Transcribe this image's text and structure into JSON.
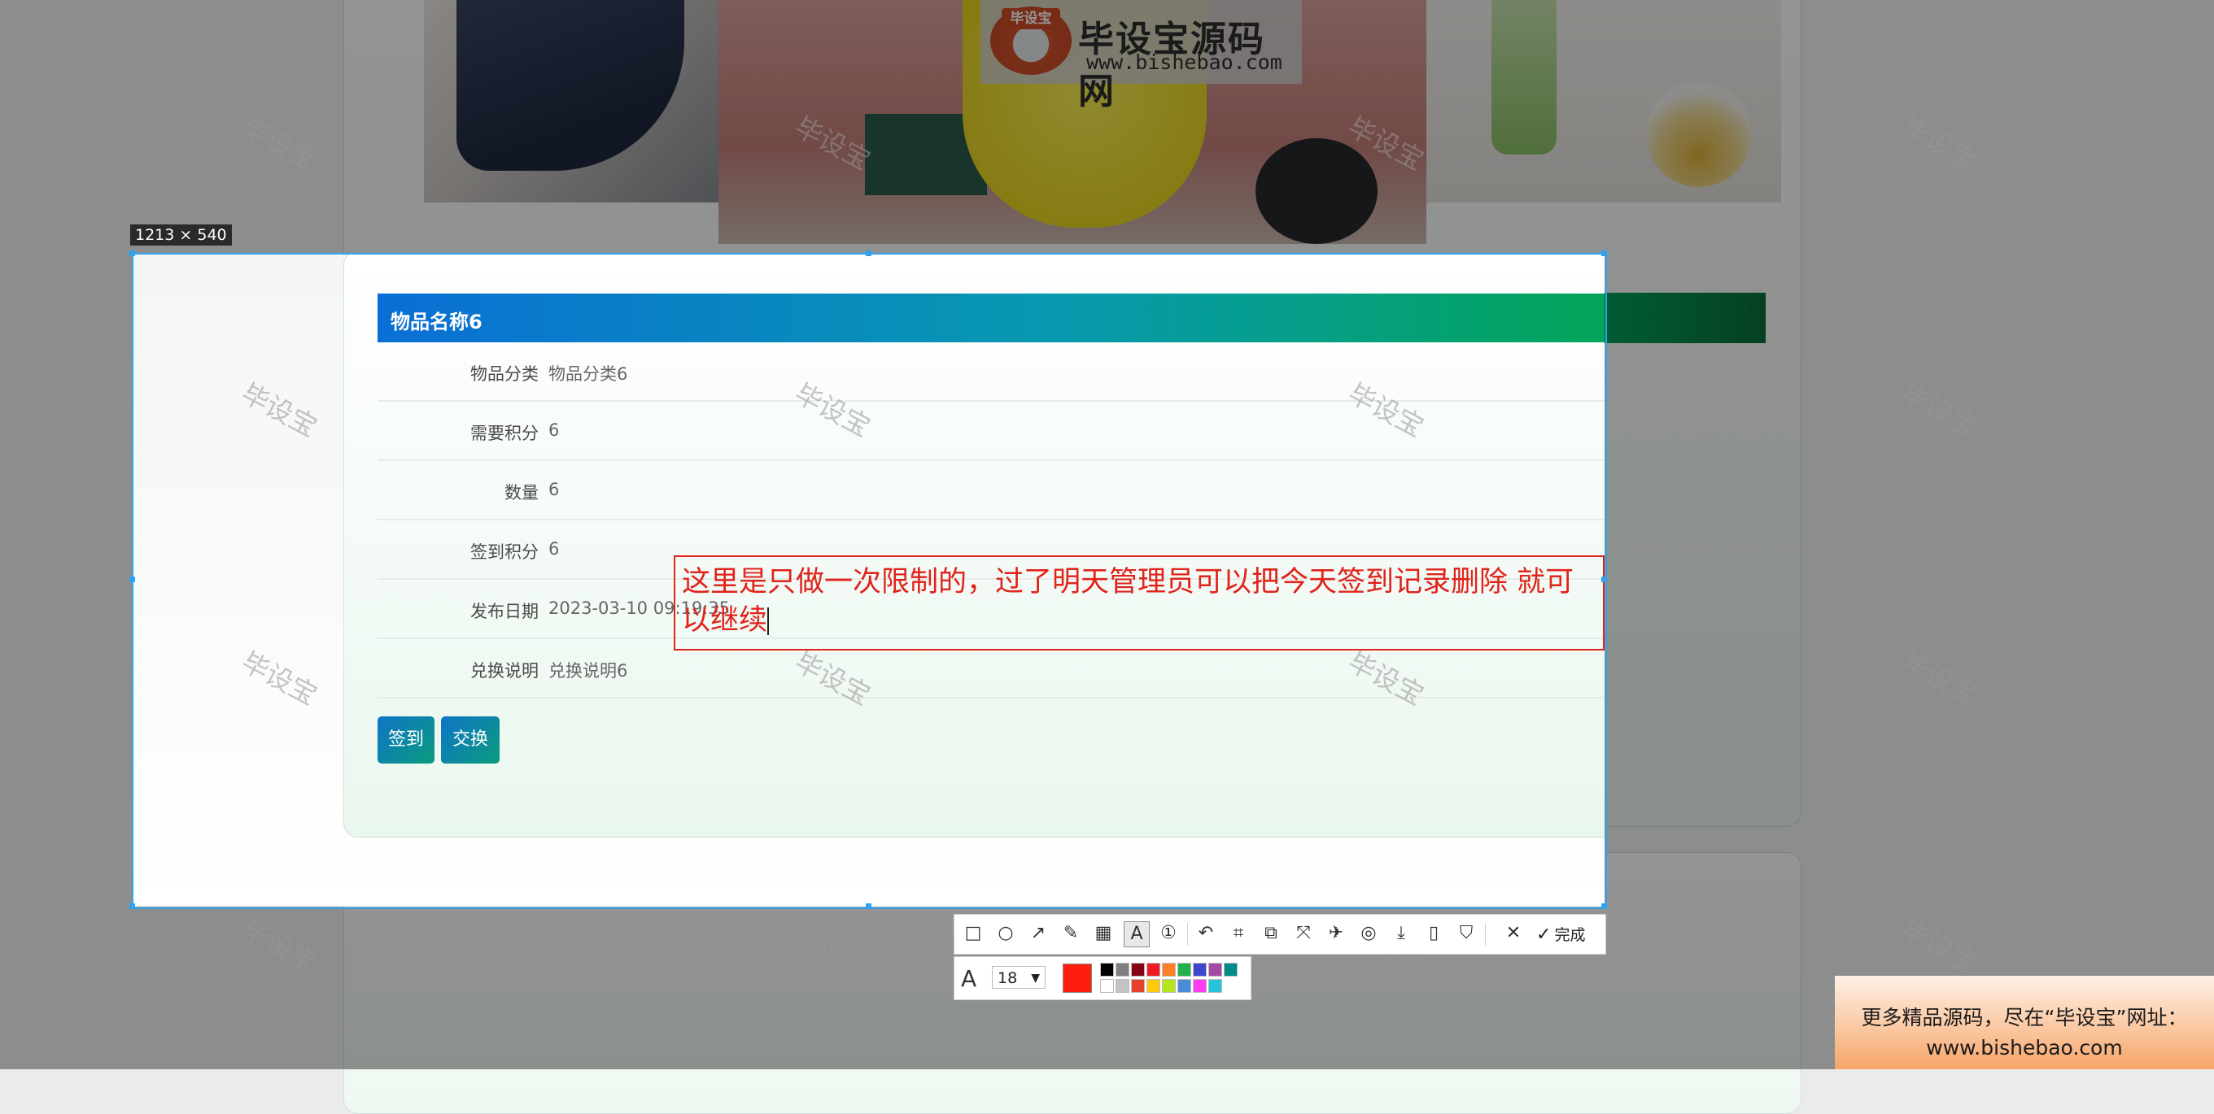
{
  "selection": {
    "dimensions": "1213 × 540"
  },
  "detail": {
    "title": "物品名称6",
    "rows": [
      {
        "label": "物品分类",
        "value": "物品分类6"
      },
      {
        "label": "需要积分",
        "value": "6"
      },
      {
        "label": "数量",
        "value": "6"
      },
      {
        "label": "签到积分",
        "value": "6"
      },
      {
        "label": "发布日期",
        "value": "2023-03-10 09:19:35"
      },
      {
        "label": "兑换说明",
        "value": "兑换说明6"
      }
    ],
    "buttons": {
      "signin": "签到",
      "exchange": "交换"
    }
  },
  "annotation": {
    "text": "这里是只做一次限制的，过了明天管理员可以把今天签到记录删除 就可以继续"
  },
  "watermark": {
    "text": "毕设宝",
    "logo_badge": "毕设宝",
    "logo_title": "毕设宝源码网",
    "logo_url": "www.bishebao.com"
  },
  "toolbar": {
    "icons": [
      "rectangle-icon",
      "ellipse-icon",
      "arrow-icon",
      "pencil-icon",
      "mosaic-icon",
      "text-icon",
      "serial-number-icon",
      "undo-icon",
      "screenshot-region-icon",
      "copy-icon",
      "scroll-capture-icon",
      "pin-icon",
      "ocr-icon",
      "save-icon",
      "long-screenshot-icon",
      "bookmark-icon",
      "close-icon"
    ],
    "done_label": "完成"
  },
  "text_options": {
    "font_size": "18",
    "current_color": "#ff1e0e",
    "palette": [
      "#000000",
      "#7f7f7f",
      "#880015",
      "#ed1c24",
      "#ff7f27",
      "#22b14c",
      "#3f48cc",
      "#a349a4",
      "#008b8b",
      "#ffffff",
      "#c3c3c3",
      "#e5422b",
      "#ffc90e",
      "#b5e61d",
      "#4b8bd8",
      "#ff3cf0",
      "#27c3d8"
    ]
  },
  "promo": {
    "line1": "更多精品源码，尽在“毕设宝”网址：",
    "line2": "www.bishebao.com"
  },
  "colors": {
    "header_start": "#0a6fd5",
    "header_end": "#03a458",
    "annotation": "#e0231b",
    "selection_border": "#2ea3f2"
  }
}
